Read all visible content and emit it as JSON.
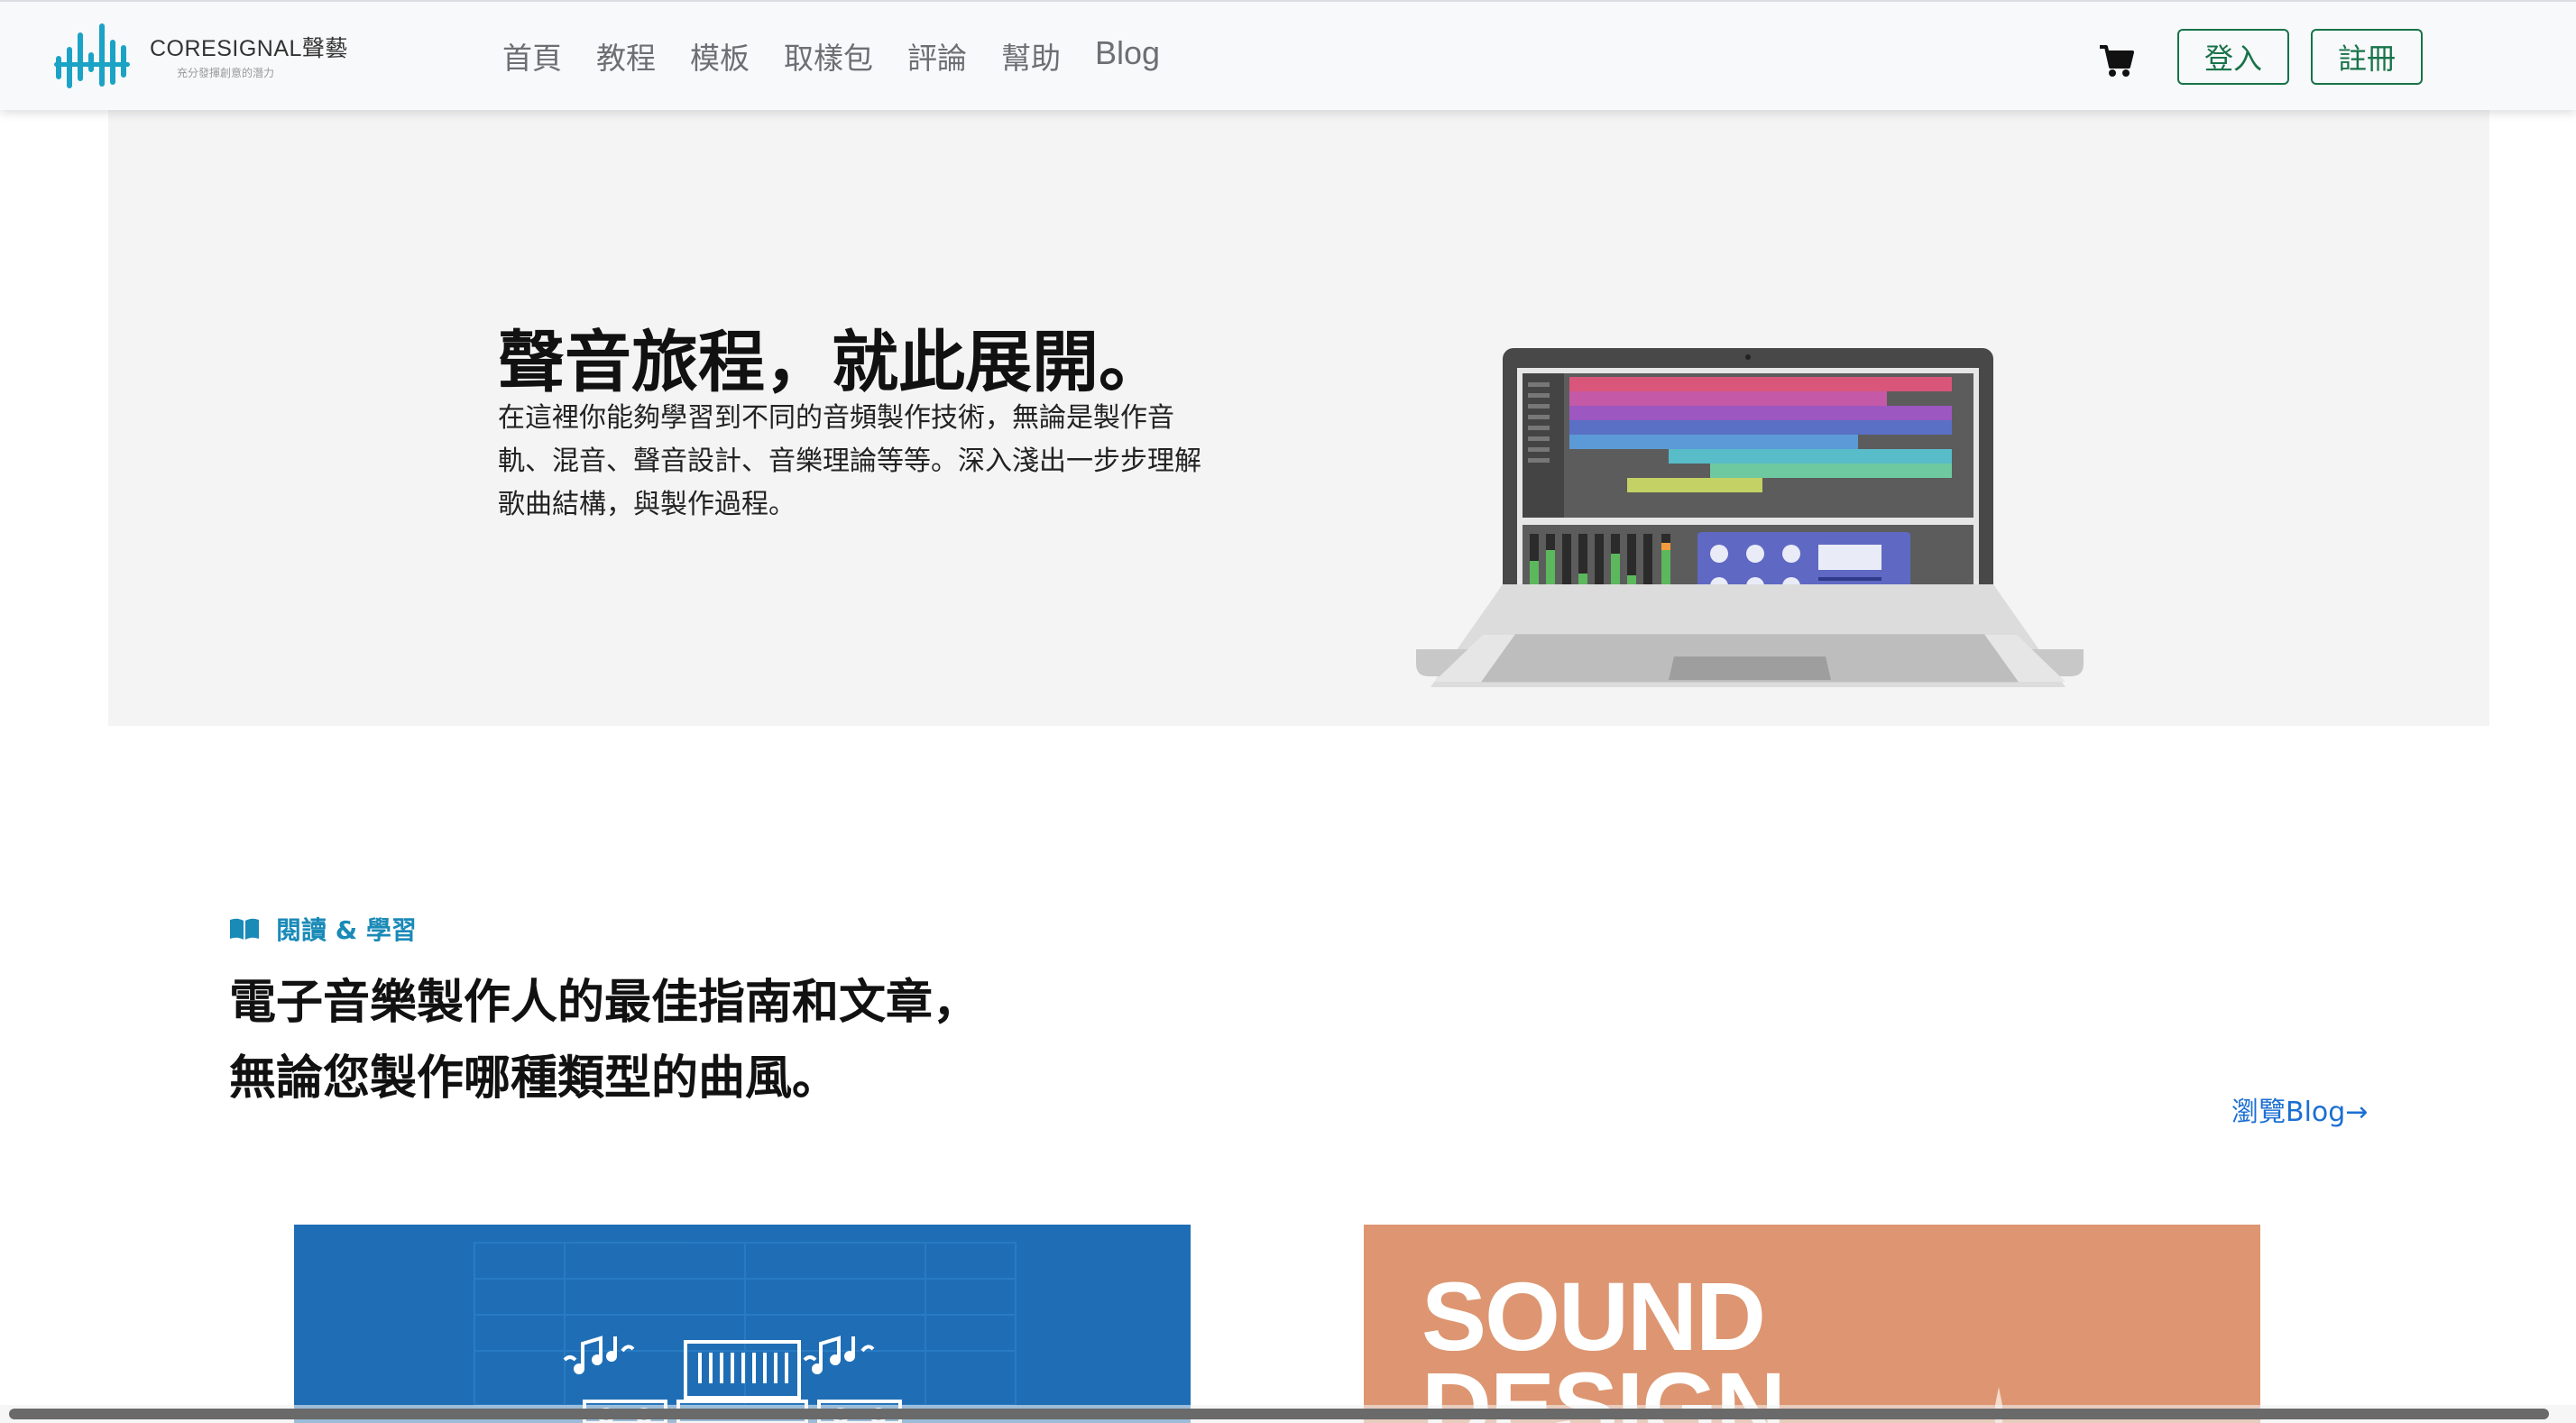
{
  "header": {
    "logo_name": "CORESIGNAL聲藝",
    "logo_tagline": "充分發揮創意的潛力",
    "nav": [
      "首頁",
      "教程",
      "模板",
      "取樣包",
      "評論",
      "幫助",
      "Blog"
    ],
    "login_label": "登入",
    "signup_label": "註冊"
  },
  "hero": {
    "title": "聲音旅程，就此展開。",
    "description": "在這裡你能夠學習到不同的音頻製作技術，無論是製作音軌、混音、聲音設計、音樂理論等等。深入淺出一步步理解歌曲結構，與製作過程。"
  },
  "section": {
    "label": "閱讀 & 學習",
    "heading_line1": "電子音樂製作人的最佳指南和文章，",
    "heading_line2": "無論您製作哪種類型的曲風。",
    "browse_link": "瀏覽Blog→"
  },
  "cards": {
    "right_title_line1": "SOUND",
    "right_title_line2": "DESIGN"
  },
  "colors": {
    "accent_green": "#18734a",
    "label_blue": "#1a8ab7",
    "link_blue": "#1b6fd2",
    "card_blue": "#1f6eb5",
    "card_orange": "#dd9671"
  }
}
